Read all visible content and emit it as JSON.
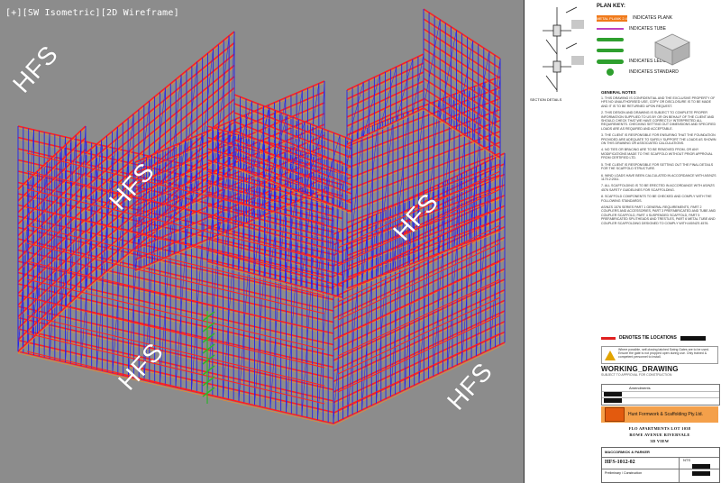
{
  "viewport": {
    "label": "[+][SW Isometric][2D Wireframe]",
    "watermark": "HFS",
    "colors": {
      "background": "#8c8c8c",
      "standard": "#2222ee",
      "plank": "#ff2020",
      "ledger": "#ff8a1a"
    }
  },
  "sheet": {
    "section_label": "SECTION DETAILS",
    "key_title": "PLAN KEY:",
    "key_items": [
      {
        "label": "INDICATES PLANK",
        "swatch_text": "METAL PLANK 2.4 M",
        "color": "#f07a1a"
      },
      {
        "label": "INDICATES TUBE",
        "color": "#c040c0"
      },
      {
        "label": "",
        "color": "#2e9f2e"
      },
      {
        "label": "",
        "color": "#2e9f2e"
      },
      {
        "label": "INDICATES LEDGER",
        "color": "#2e9f2e"
      },
      {
        "label": "INDICATES STANDARD",
        "color": "#2e9f2e"
      }
    ],
    "notes_title": "GENERAL NOTES",
    "notes": [
      "1. THIS DRAWING IS CONFIDENTIAL AND THE EXCLUSIVE PROPERTY OF HFS NO UNAUTHORISED USE, COPY OR DISCLOSURE IS TO BE MADE AND IT IS TO BE RETURNED UPON REQUEST.",
      "2. THIS DESIGN AND DRAWING IS SUBJECT TO COMPLETE PROPER INFORMATION SUPPLIED TO US BY OR ON BEHALF OF THE CLIENT AND SHOULD CHECK THAT WE HAVE CORRECTLY INTERPRETED ALL REQUIREMENTS. CHECKING SETTING OUT DIMENSIONS AND SPECIFIED LOADS ARE AS REQUIRED AND ACCEPTABLE.",
      "3. THE CLIENT IS RESPONSIBLE FOR ENSURING THAT THE FOUNDATION PROVIDED ARE ADEQUATE TO SAFELY SUPPORT THE LOADS AS SHOWN ON THIS DRAWING OR ASSOCIATED CALCULATIONS.",
      "4. NO TIES OR BRACING ARE TO BE REMOVED FROM, OR ANY MODIFICATIONS MADE TO THE SCAFFOLD WITHOUT PRIOR APPROVAL FROM CERTIFIED LTD.",
      "5. THE CLIENT IS RESPONSIBLE FOR SETTING OUT THE FINAL DETAILS FOR THE SCAFFOLD STRUCTURE.",
      "6. WIND LOADS HAVE BEEN CALCULATED IN ACCORDANCE WITH AS/NZS 1170.2:2011.",
      "7. ALL SCAFFOLDING IS TO BE ERECTED IN ACCORDANCE WITH AS/NZS 4576 SAFETY GUIDELINES FOR SCAFFOLDING.",
      "8. SCAFFOLD COMPONENTS TO BE CHECKED AND COMPLY WITH THE FOLLOWING STANDARDS.",
      "AS/NZS 1576 SERIES PART 1 GENERAL REQUIREMENTS, PART 2 COUPLERS AND ACCESSORIES, PART 3 PREFABRICATED AND TUBE AND COUPLER SCAFFOLD, PART 4 SUSPENDED SCAFFOLD, PART 5 PREFABRICATED SPLITHEADS AND TRESTLES, PART 6 METAL TUBE AND COUPLER SCAFFOLDING DESIGNED TO COMPLY WITH AS/NZS 4576."
    ],
    "tie_label": "DENOTES TIE LOCATIONS",
    "warning_text": "Where possible, self-closing latched Swing Gates are to be used. Ensure the gate is not propped open during use. Only trained & competent personnel to install.",
    "working_title": "WORKING_DRAWING",
    "working_sub": "SUBJECT TO APPROVAL FOR CONSTRUCTION",
    "rev_header": "Amendments",
    "company": "Hunt Formwork & Scaffolding Pty.Ltd.",
    "project_lines": [
      "FLO APARTMENTS LOT 1038",
      "ROWE AVENUE RIVERVALE",
      "3D VIEW"
    ],
    "client_line": "MACCORMICK & PARKER",
    "drawing_number": "HFS-1012-02",
    "status_text": "Preliminary / Construction",
    "scale_label": "NTS"
  }
}
